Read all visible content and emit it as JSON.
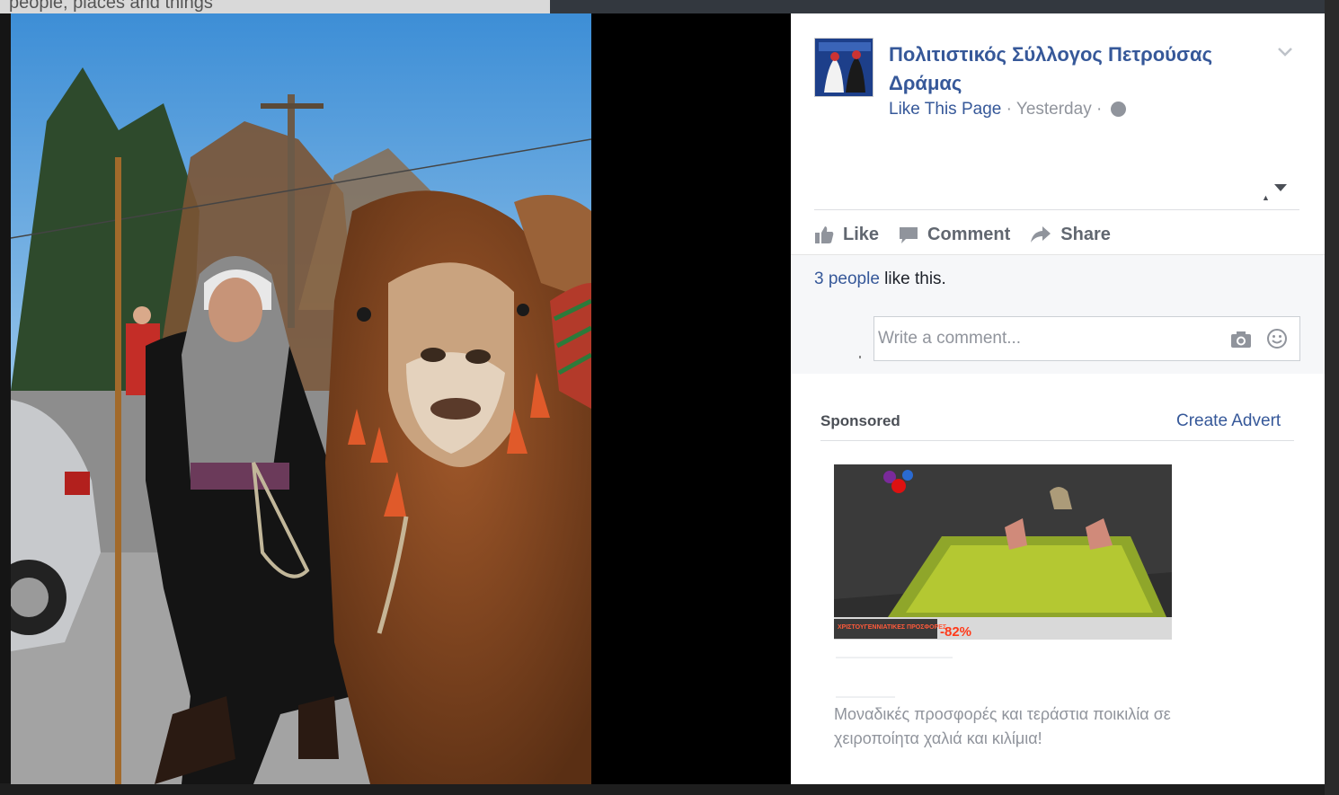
{
  "background": {
    "top_left_text": "people, places and things"
  },
  "post": {
    "page_name": "Πολιτιστικός Σύλλογος Πετρούσας Δράμας",
    "like_page": "Like This Page",
    "separator": "·",
    "time": "Yesterday",
    "privacy_icon": "globe-icon"
  },
  "actions": {
    "like": "Like",
    "comment": "Comment",
    "share": "Share"
  },
  "likes": {
    "people": "3 people",
    "suffix": " like this."
  },
  "comment": {
    "placeholder": "Write a comment..."
  },
  "sponsored": {
    "label": "Sponsored",
    "create_advert": "Create Advert",
    "ad_banner_text": "ΧΡΙΣΤΟΥΓΕΝΝΙΑΤΙΚΕΣ ΠΡΟΣΦΟΡΕΣ",
    "ad_discount": "-82%",
    "ad_description": "Μοναδικές προσφορές και τεράστια ποικιλία σε χειροποίητα χαλιά και κιλίμια!"
  },
  "colors": {
    "link": "#365899",
    "muted": "#90949c",
    "action": "#616770"
  }
}
